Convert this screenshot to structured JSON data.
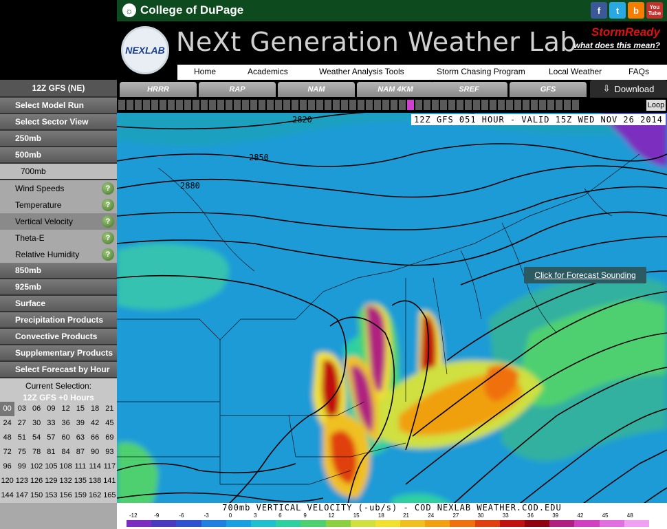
{
  "header": {
    "college": "College of DuPage",
    "site_title": "NeXt Generation Weather Lab",
    "logo_text": "NEXLAB",
    "storm_ready": "StormReady",
    "what_does": "what does this mean?",
    "social": [
      "f",
      "t",
      "b",
      "You Tube"
    ]
  },
  "nav": {
    "items": [
      "Home",
      "Academics",
      "Weather Analysis Tools",
      "Storm Chasing Program",
      "Local Weather",
      "FAQs"
    ]
  },
  "sidebar": {
    "model_title": "12Z GFS (NE)",
    "select_run": "Select Model Run",
    "select_sector": "Select Sector View",
    "levels_top": [
      "250mb",
      "500mb"
    ],
    "level_700": "700mb",
    "subitems": [
      "Wind Speeds",
      "Temperature",
      "Vertical Velocity",
      "Theta-E",
      "Relative Humidity"
    ],
    "levels_bottom": [
      "850mb",
      "925mb",
      "Surface",
      "Precipitation Products",
      "Convective Products",
      "Supplementary Products",
      "Select Forecast by Hour"
    ],
    "current_selection_label": "Current Selection:",
    "current_selection_value": "12Z GFS +0 Hours",
    "hours": [
      "00",
      "03",
      "06",
      "09",
      "12",
      "15",
      "18",
      "21",
      "24",
      "27",
      "30",
      "33",
      "36",
      "39",
      "42",
      "45",
      "48",
      "51",
      "54",
      "57",
      "60",
      "63",
      "66",
      "69",
      "72",
      "75",
      "78",
      "81",
      "84",
      "87",
      "90",
      "93",
      "96",
      "99",
      "102",
      "105",
      "108",
      "111",
      "114",
      "117",
      "120",
      "123",
      "126",
      "129",
      "132",
      "135",
      "138",
      "141",
      "144",
      "147",
      "150",
      "153",
      "156",
      "159",
      "162",
      "165"
    ]
  },
  "model_tabs": [
    "HRRR",
    "RAP",
    "NAM",
    "NAM 4KM",
    "SREF",
    "GFS"
  ],
  "download_label": "Download",
  "loop_label": "Loop",
  "loop_current_frame": 35,
  "map": {
    "valid_text": "12Z GFS 051 HOUR - VALID 15Z WED NOV 26 2014",
    "sounding_link": "Click for Forecast Sounding",
    "contour_labels": [
      "2820",
      "2850",
      "2880"
    ],
    "footer_title": "700mb VERTICAL VELOCITY (-ub/s) - COD NEXLAB   WEATHER.COD.EDU",
    "colorbar_labels": [
      "-12",
      "-9",
      "-6",
      "-3",
      "0",
      "3",
      "6",
      "9",
      "12",
      "15",
      "18",
      "21",
      "24",
      "27",
      "30",
      "33",
      "36",
      "39",
      "42",
      "45",
      "48"
    ],
    "colorbar_colors": [
      "#7b2dbf",
      "#4a3ac0",
      "#3050d0",
      "#2080e0",
      "#19a0e0",
      "#20c0d0",
      "#2fd0a0",
      "#4fd070",
      "#8ad040",
      "#cfe040",
      "#f0e030",
      "#f0c020",
      "#f0a010",
      "#f07010",
      "#e04010",
      "#c01010",
      "#900010",
      "#b02080",
      "#d040c0",
      "#e070e0",
      "#f0a0f0"
    ]
  }
}
